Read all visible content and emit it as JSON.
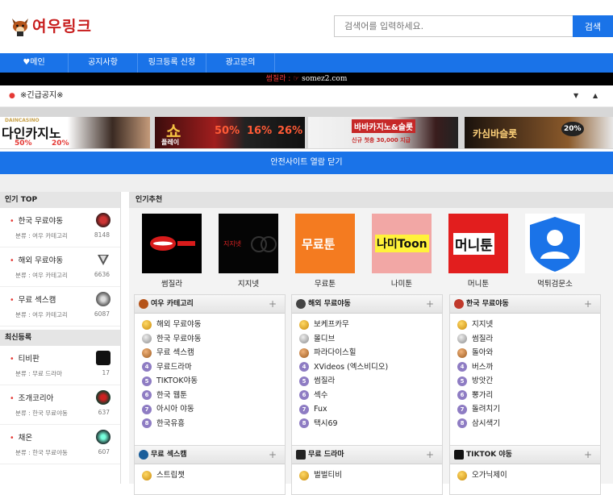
{
  "header": {
    "logo_text": "여우링크",
    "search_placeholder": "검색어를 입력하세요.",
    "search_button": "검색"
  },
  "nav": {
    "items": [
      "♥메인",
      "공지사항",
      "링크등록 신청",
      "광고문의"
    ]
  },
  "ticker": {
    "text1": "썸질라 : ☞",
    "text2": "somez2.com"
  },
  "notice": {
    "label": "※긴급공지※"
  },
  "banners": [
    {
      "line1": "DAINCASINO",
      "line2": "다인카지노",
      "line3": "50%",
      "line4": "20%"
    },
    {
      "line1": "쇼",
      "line2": "플레이",
      "line3": "50%",
      "line4": "16%",
      "line5": "26%"
    },
    {
      "line1": "바바카지노&슬롯",
      "line2": "신규 첫충 30,000 지급"
    },
    {
      "line1": "카심바슬롯",
      "line2": "20%"
    }
  ],
  "safe_bar": {
    "label": "안전사이트 열람 닫기"
  },
  "colors": {
    "accent": "#1a73e8",
    "red": "#e53935"
  },
  "sidebar": {
    "top_title": "인기 TOP",
    "top_items": [
      {
        "name": "한국 무료야동",
        "sub": "분류 : 여우 카테고리",
        "count": "8148"
      },
      {
        "name": "해외 무료야동",
        "sub": "분류 : 여우 카테고리",
        "count": "6636"
      },
      {
        "name": "무료 섹스캠",
        "sub": "분류 : 여우 카테고리",
        "count": "6087"
      }
    ],
    "new_title": "최신등록",
    "new_items": [
      {
        "name": "티비판",
        "sub": "분류 : 무료 드라마",
        "count": "17"
      },
      {
        "name": "조개코리아",
        "sub": "분류 : 한국 무료야동",
        "count": "637"
      },
      {
        "name": "채온",
        "sub": "분류 : 한국 무료야동",
        "count": "607"
      }
    ]
  },
  "main": {
    "title": "인기추천",
    "recommended": [
      "썸질라",
      "지지넷",
      "무료툰",
      "나미툰",
      "머니툰",
      "먹튀검문소"
    ],
    "rec_images": {
      "mufree": "무료툰",
      "nami": "나미Toon",
      "money": "머니툰",
      "jiji": "지지넷"
    },
    "cards": [
      {
        "title": "여우 카테고리",
        "items": [
          "해외 무료야동",
          "한국 무료야동",
          "무료 섹스캠",
          "무료드라마",
          "TIKTOK야동",
          "한국 웹툰",
          "아시아 야동",
          "한국유흥"
        ]
      },
      {
        "title": "해외 무료야동",
        "items": [
          "보케프카무",
          "몰디브",
          "파라다이스힐",
          "XVideos (엑스비디오)",
          "썸질라",
          "섹수",
          "Fux",
          "택시69"
        ]
      },
      {
        "title": "한국 무료야동",
        "items": [
          "지지넷",
          "썸질라",
          "돌아와",
          "버스까",
          "방앗간",
          "뽕가리",
          "돌려치기",
          "삼시색기"
        ]
      },
      {
        "title": "무료 섹스캠",
        "items": [
          "스트립챗"
        ]
      },
      {
        "title": "무료 드라마",
        "items": [
          "벌벌티비"
        ]
      },
      {
        "title": "TIKTOK 야동",
        "items": [
          "오가닉제이"
        ]
      }
    ],
    "plus": "+"
  }
}
